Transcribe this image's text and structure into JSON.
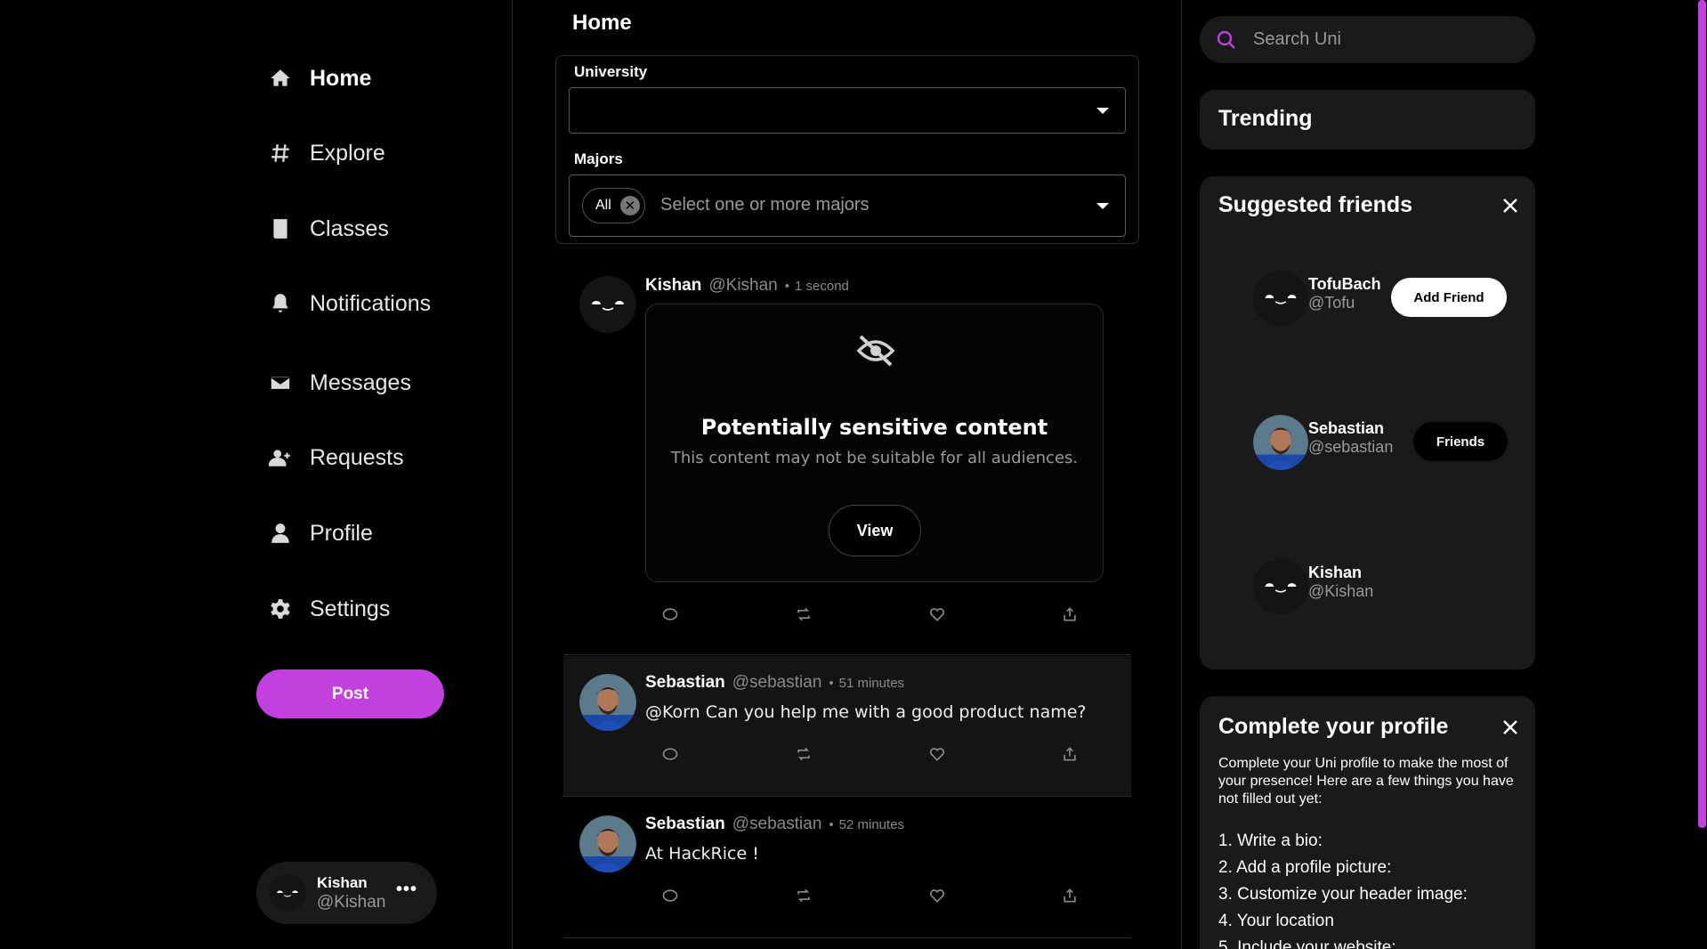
{
  "nav": {
    "items": [
      {
        "label": "Home",
        "icon": "home-icon"
      },
      {
        "label": "Explore",
        "icon": "hash-icon"
      },
      {
        "label": "Classes",
        "icon": "book-icon"
      },
      {
        "label": "Notifications",
        "icon": "bell-icon"
      },
      {
        "label": "Messages",
        "icon": "envelope-icon"
      },
      {
        "label": "Requests",
        "icon": "user-plus-icon"
      },
      {
        "label": "Profile",
        "icon": "user-icon"
      },
      {
        "label": "Settings",
        "icon": "gear-icon"
      }
    ],
    "post_label": "Post"
  },
  "current_user": {
    "name": "Kishan",
    "handle": "@Kishan",
    "more": "•••"
  },
  "main": {
    "title": "Home",
    "filters": {
      "university_label": "University",
      "university_value": "",
      "majors_label": "Majors",
      "majors_chip": "All",
      "majors_placeholder": "Select one or more majors"
    },
    "posts": [
      {
        "name": "Kishan",
        "handle": "@Kishan",
        "dot": "•",
        "time": "1 second",
        "sensitive": {
          "title": "Potentially sensitive content",
          "desc": "This content may not be suitable for all audiences.",
          "view_label": "View"
        }
      },
      {
        "name": "Sebastian",
        "handle": "@sebastian",
        "dot": "•",
        "time": "51 minutes",
        "text": "@Korn Can you help me with a good product name?"
      },
      {
        "name": "Sebastian",
        "handle": "@sebastian",
        "dot": "•",
        "time": "52 minutes",
        "text": "At HackRice !"
      }
    ]
  },
  "right": {
    "search_placeholder": "Search Uni",
    "trending_title": "Trending",
    "suggested": {
      "title": "Suggested friends",
      "friends": [
        {
          "name": "TofuBach",
          "handle": "@Tofu",
          "button": "Add Friend"
        },
        {
          "name": "Sebastian",
          "handle": "@sebastian",
          "button": "Friends"
        },
        {
          "name": "Kishan",
          "handle": "@Kishan"
        }
      ]
    },
    "complete_profile": {
      "title": "Complete your profile",
      "text": "Complete your Uni profile to make the most of your presence! Here are a few things you have not filled out yet:",
      "items": [
        "1. Write a bio:",
        "2. Add a profile picture:",
        "3. Customize your header image:",
        "4. Your location",
        "5. Include your website:"
      ]
    }
  },
  "colors": {
    "accent": "#c43fdf",
    "background": "#000000",
    "card": "#1a1a1a"
  }
}
